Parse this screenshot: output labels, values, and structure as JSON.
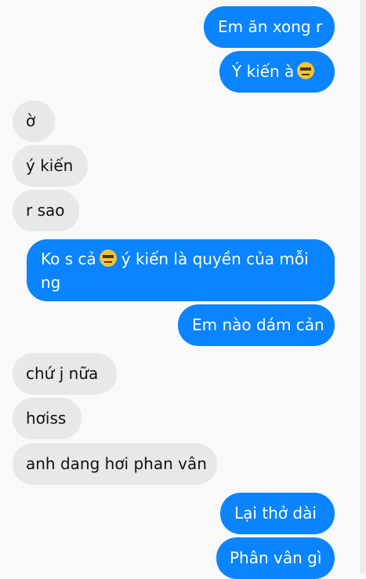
{
  "conversation": {
    "messages": [
      {
        "direction": "outgoing",
        "text": "Em ăn xong r"
      },
      {
        "direction": "outgoing",
        "text": "Ý kiến à",
        "emoji": "expressionless-face"
      },
      {
        "direction": "incoming",
        "text": "ờ"
      },
      {
        "direction": "incoming",
        "text": "ý kiến"
      },
      {
        "direction": "incoming",
        "text": "r sao"
      },
      {
        "direction": "outgoing",
        "text_before": "Ko s cả",
        "emoji": "expressionless-face",
        "text_after": "ý kiến là quyền của mỗi ng"
      },
      {
        "direction": "outgoing",
        "text": "Em nào dám cản"
      },
      {
        "direction": "incoming",
        "text": "chứ j nữa"
      },
      {
        "direction": "incoming",
        "text": "hơiss"
      },
      {
        "direction": "incoming",
        "text": "anh dang hơi phan vân"
      },
      {
        "direction": "outgoing",
        "text": "Lại thở dài"
      },
      {
        "direction": "outgoing",
        "text": "Phân vân gì"
      }
    ]
  },
  "colors": {
    "outgoing_bubble": "#0a84ff",
    "incoming_bubble": "#e8e8e8",
    "background": "#f9f9f9"
  }
}
